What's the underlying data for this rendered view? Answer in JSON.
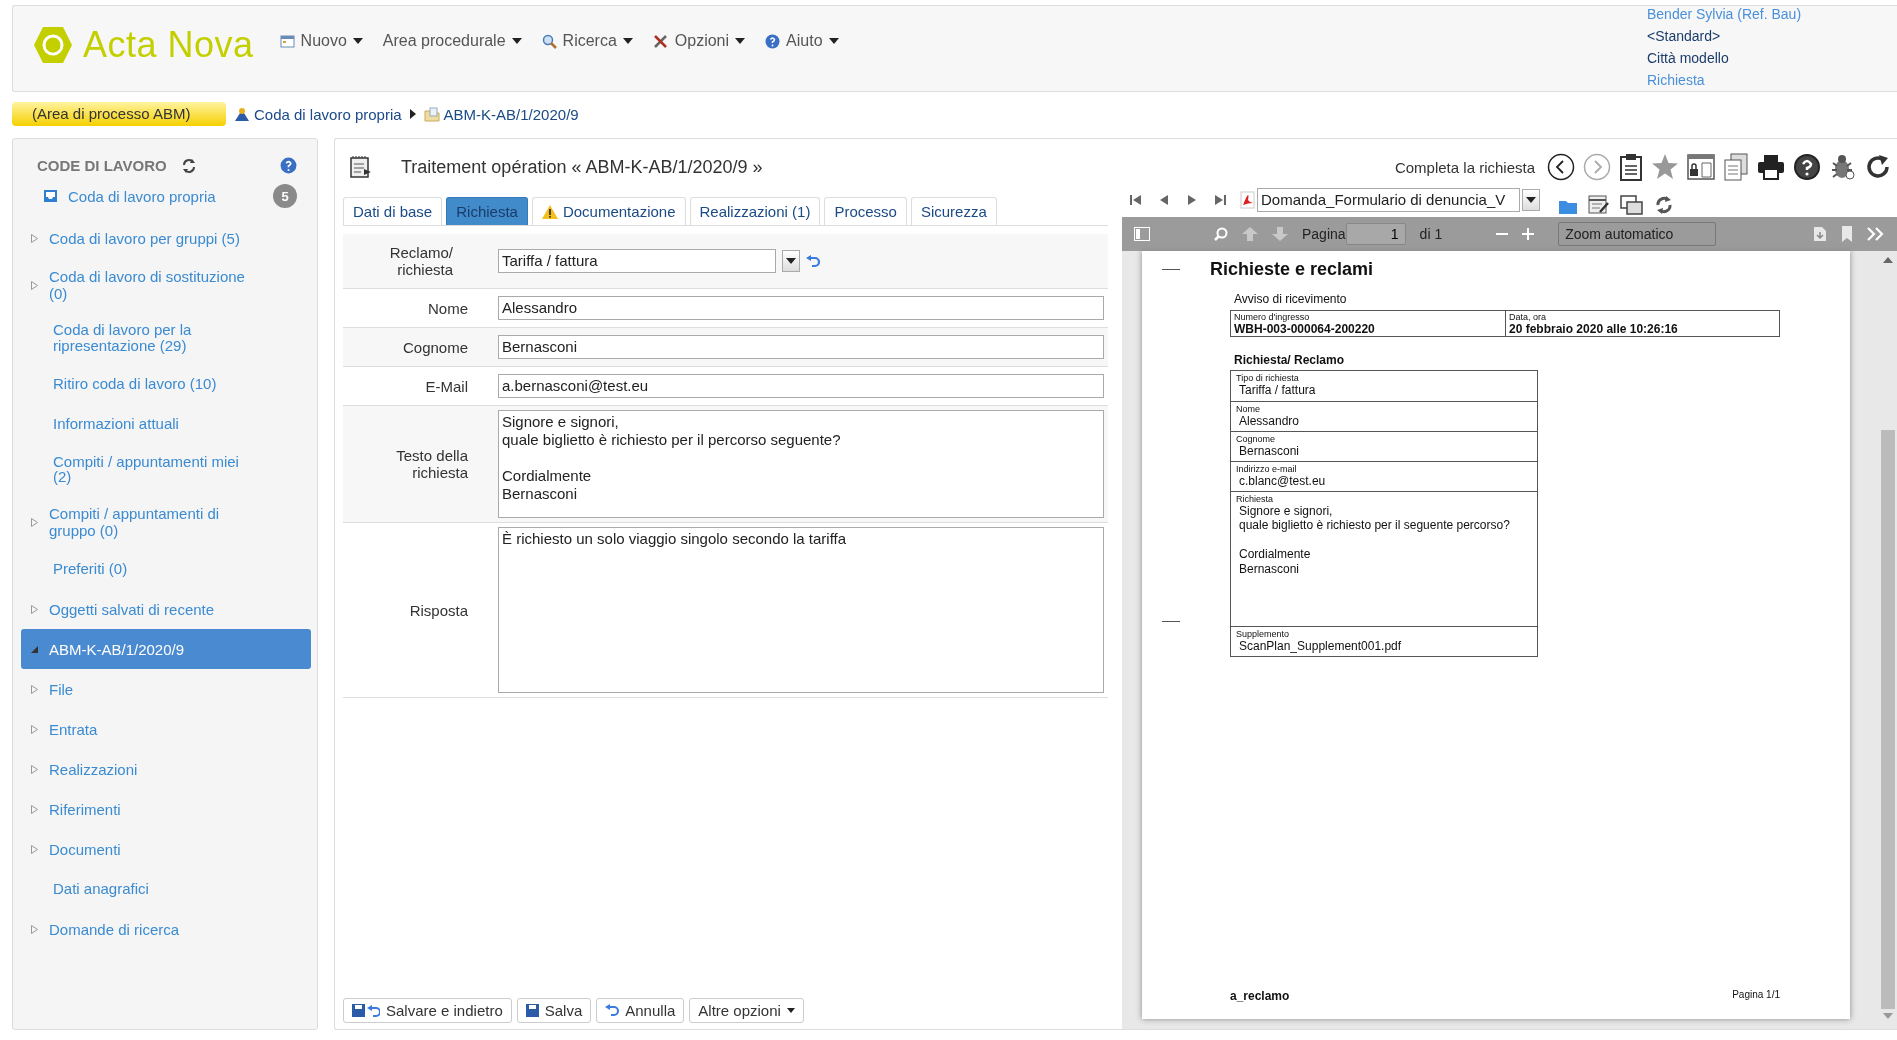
{
  "header": {
    "logo": "Acta Nova",
    "menu": [
      {
        "label": "Nuovo"
      },
      {
        "label": "Area procedurale"
      },
      {
        "label": "Ricerca"
      },
      {
        "label": "Opzioni"
      },
      {
        "label": "Aiuto"
      }
    ],
    "user_info": [
      {
        "text": "Bender Sylvia (Ref. Bau)",
        "kind": "link"
      },
      {
        "text": "<Standard>",
        "kind": "text"
      },
      {
        "text": "Città modello",
        "kind": "text"
      },
      {
        "text": "Richiesta",
        "kind": "link"
      }
    ]
  },
  "breadcrumb": {
    "area": "(Area di processo ABM)",
    "items": [
      {
        "label": "Coda di lavoro propria"
      },
      {
        "label": "ABM-K-AB/1/2020/9"
      }
    ]
  },
  "sidebar": {
    "title": "CODE DI LAVORO",
    "own_queue": {
      "label": "Coda di lavoro propria",
      "badge": "5"
    },
    "items": [
      {
        "label": "Coda di lavoro per gruppi (5)",
        "kind": "branch",
        "selected": false
      },
      {
        "label": "Coda di lavoro  di sostituzione (0)",
        "kind": "branch",
        "selected": false
      },
      {
        "label": "Coda di lavoro per la ripresentazione (29)",
        "kind": "leaf",
        "selected": false
      },
      {
        "label": "Ritiro coda di lavoro (10)",
        "kind": "leaf",
        "selected": false
      },
      {
        "label": "Informazioni attuali",
        "kind": "leaf",
        "selected": false
      },
      {
        "label": "Compiti / appuntamenti miei (2)",
        "kind": "leaf",
        "selected": false
      },
      {
        "label": "Compiti / appuntamenti di gruppo (0)",
        "kind": "branch",
        "selected": false
      },
      {
        "label": "Preferiti (0)",
        "kind": "leaf",
        "selected": false
      },
      {
        "label": "Oggetti salvati di recente",
        "kind": "branch",
        "selected": false
      },
      {
        "label": "ABM-K-AB/1/2020/9",
        "kind": "open",
        "selected": true
      },
      {
        "label": "File",
        "kind": "branch",
        "selected": false
      },
      {
        "label": "Entrata",
        "kind": "branch",
        "selected": false
      },
      {
        "label": "Realizzazioni",
        "kind": "branch",
        "selected": false
      },
      {
        "label": "Riferimenti",
        "kind": "branch",
        "selected": false
      },
      {
        "label": "Documenti",
        "kind": "branch",
        "selected": false
      },
      {
        "label": "Dati anagrafici",
        "kind": "leaf",
        "selected": false
      },
      {
        "label": "Domande di ricerca",
        "kind": "branch",
        "selected": false
      }
    ]
  },
  "main": {
    "title": "Traitement opération « ABM-K-AB/1/2020/9 »",
    "tabs": [
      {
        "label": "Dati di base",
        "selected": false,
        "warning": false
      },
      {
        "label": "Richiesta",
        "selected": true,
        "warning": false
      },
      {
        "label": "Documentazione",
        "selected": false,
        "warning": true
      },
      {
        "label": "Realizzazioni (1)",
        "selected": false,
        "warning": false
      },
      {
        "label": "Processo",
        "selected": false,
        "warning": false
      },
      {
        "label": "Sicurezza",
        "selected": false,
        "warning": false
      }
    ],
    "fields": [
      {
        "label": "Reclamo/ richiesta",
        "value": "Tariffa / fattura",
        "kind": "select"
      },
      {
        "label": "Nome",
        "value": "Alessandro",
        "kind": "input"
      },
      {
        "label": "Cognome",
        "value": "Bernasconi",
        "kind": "input"
      },
      {
        "label": "E-Mail",
        "value": "a.bernasconi@test.eu",
        "kind": "input"
      },
      {
        "label": "Testo della richiesta",
        "value": "Signore e signori,\nquale biglietto è richiesto per il percorso seguente?\n\nCordialmente\nBernasconi",
        "kind": "textarea"
      },
      {
        "label": "Risposta",
        "value": "È richiesto un solo viaggio singolo secondo la tariffa",
        "kind": "textarea-large"
      }
    ],
    "buttons": [
      {
        "label": "Salvare e indietro"
      },
      {
        "label": "Salva"
      },
      {
        "label": "Annulla"
      },
      {
        "label": "Altre opzioni"
      }
    ]
  },
  "viewer": {
    "complete_label": "Completa la richiesta",
    "document": "Domanda_Formulario di denuncia_V",
    "toolbar": {
      "page_label": "Pagina",
      "page": "1",
      "of": "di 1",
      "zoom": "Zoom automatico"
    },
    "pdf": {
      "title": "Richieste e reclami",
      "subtitle": "Avviso di ricevimento",
      "header_cells": [
        {
          "label": "Numero d'ingresso",
          "value": "WBH-003-000064-200220"
        },
        {
          "label": "Data, ora",
          "value": "20 febbraio 2020 alle 10:26:16"
        }
      ],
      "section": "Richiesta/ Reclamo",
      "rows": [
        {
          "label": "Tipo di richiesta",
          "value": "Tariffa / fattura"
        },
        {
          "label": "Nome",
          "value": "Alessandro"
        },
        {
          "label": "Cognome",
          "value": "Bernasconi"
        },
        {
          "label": "Indirizzo e-mail",
          "value": "c.blanc@test.eu"
        },
        {
          "label": "Richiesta",
          "value": "Signore e signori,\nquale biglietto è richiesto per il seguente percorso?\n\nCordialmente\nBernasconi"
        },
        {
          "label": "Supplemento",
          "value": "ScanPlan_Supplement001.pdf"
        }
      ],
      "footer_left": "a_reclamo",
      "footer_right": "Pagina 1/1"
    }
  }
}
